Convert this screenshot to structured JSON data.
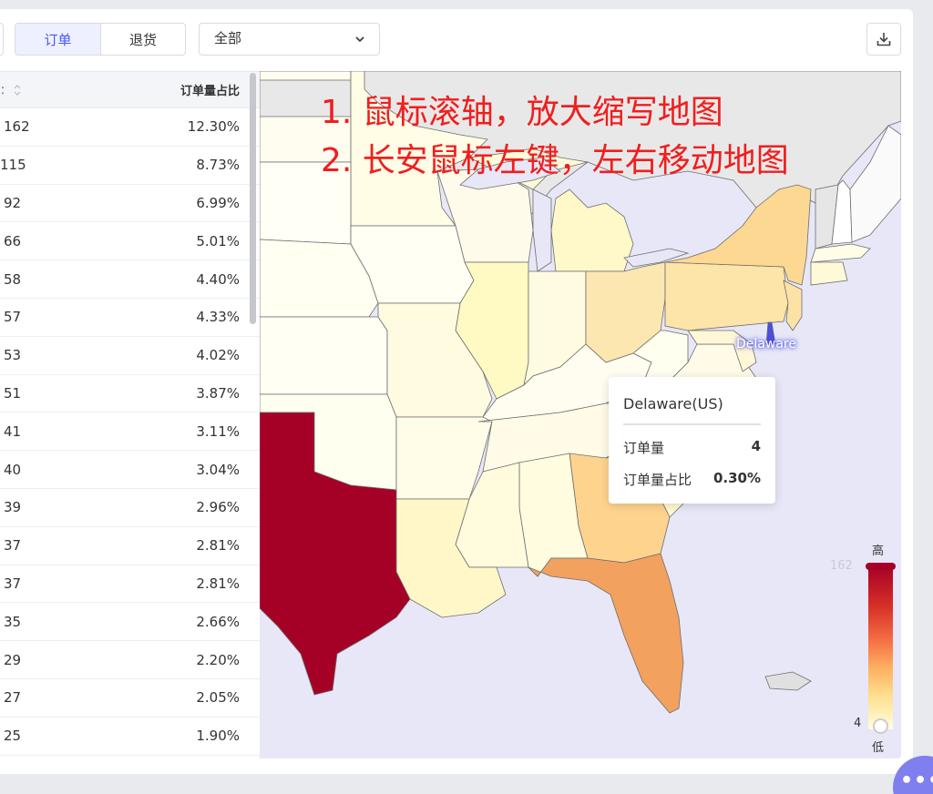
{
  "toolbar": {
    "tabs": [
      {
        "label": "订单",
        "active": true
      },
      {
        "label": "退货",
        "active": false
      }
    ],
    "select_value": "全部",
    "download_icon": "download-icon"
  },
  "table": {
    "header_right": "订单量占比",
    "rows": [
      {
        "count": "162",
        "share": "12.30%"
      },
      {
        "count": "115",
        "share": "8.73%"
      },
      {
        "count": "92",
        "share": "6.99%"
      },
      {
        "count": "66",
        "share": "5.01%"
      },
      {
        "count": "58",
        "share": "4.40%"
      },
      {
        "count": "57",
        "share": "4.33%"
      },
      {
        "count": "53",
        "share": "4.02%"
      },
      {
        "count": "51",
        "share": "3.87%"
      },
      {
        "count": "41",
        "share": "3.11%"
      },
      {
        "count": "40",
        "share": "3.04%"
      },
      {
        "count": "39",
        "share": "2.96%"
      },
      {
        "count": "37",
        "share": "2.81%"
      },
      {
        "count": "37",
        "share": "2.81%"
      },
      {
        "count": "35",
        "share": "2.66%"
      },
      {
        "count": "29",
        "share": "2.20%"
      },
      {
        "count": "27",
        "share": "2.05%"
      },
      {
        "count": "25",
        "share": "1.90%"
      }
    ]
  },
  "map": {
    "instructions": [
      "1. 鼠标滚轴，放大缩写地图",
      "2. 长安鼠标左键，左右移动地图"
    ],
    "highlight_label": "Delaware",
    "tooltip": {
      "title": "Delaware(US)",
      "rows": [
        {
          "label": "订单量",
          "value": "4"
        },
        {
          "label": "订单量占比",
          "value": "0.30%"
        }
      ]
    },
    "legend": {
      "high": "高",
      "low": "低",
      "max": "162",
      "min": "4"
    },
    "colors": {
      "max": "#a50026",
      "min": "#ffffe0",
      "highlight": "#4b4fdc",
      "ocean": "#e7e7f7"
    }
  },
  "fab_icon": "more-icon"
}
